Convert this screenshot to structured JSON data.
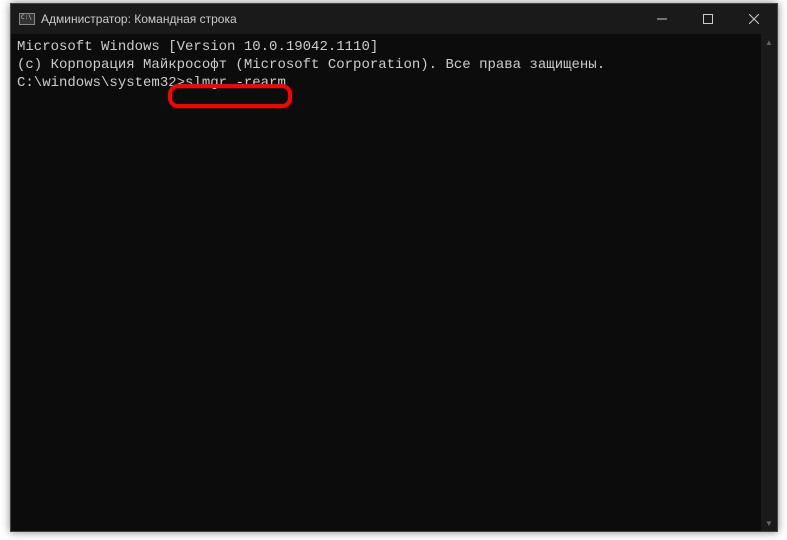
{
  "titlebar": {
    "title": "Администратор: Командная строка"
  },
  "terminal": {
    "line1": "Microsoft Windows [Version 10.0.19042.1110]",
    "line2": "(c) Корпорация Майкрософт (Microsoft Corporation). Все права защищены.",
    "blank": "",
    "prompt": "C:\\windows\\system32>",
    "command": "slmgr -rearm"
  },
  "controls": {
    "minimize": "minimize",
    "maximize": "maximize",
    "close": "close"
  }
}
